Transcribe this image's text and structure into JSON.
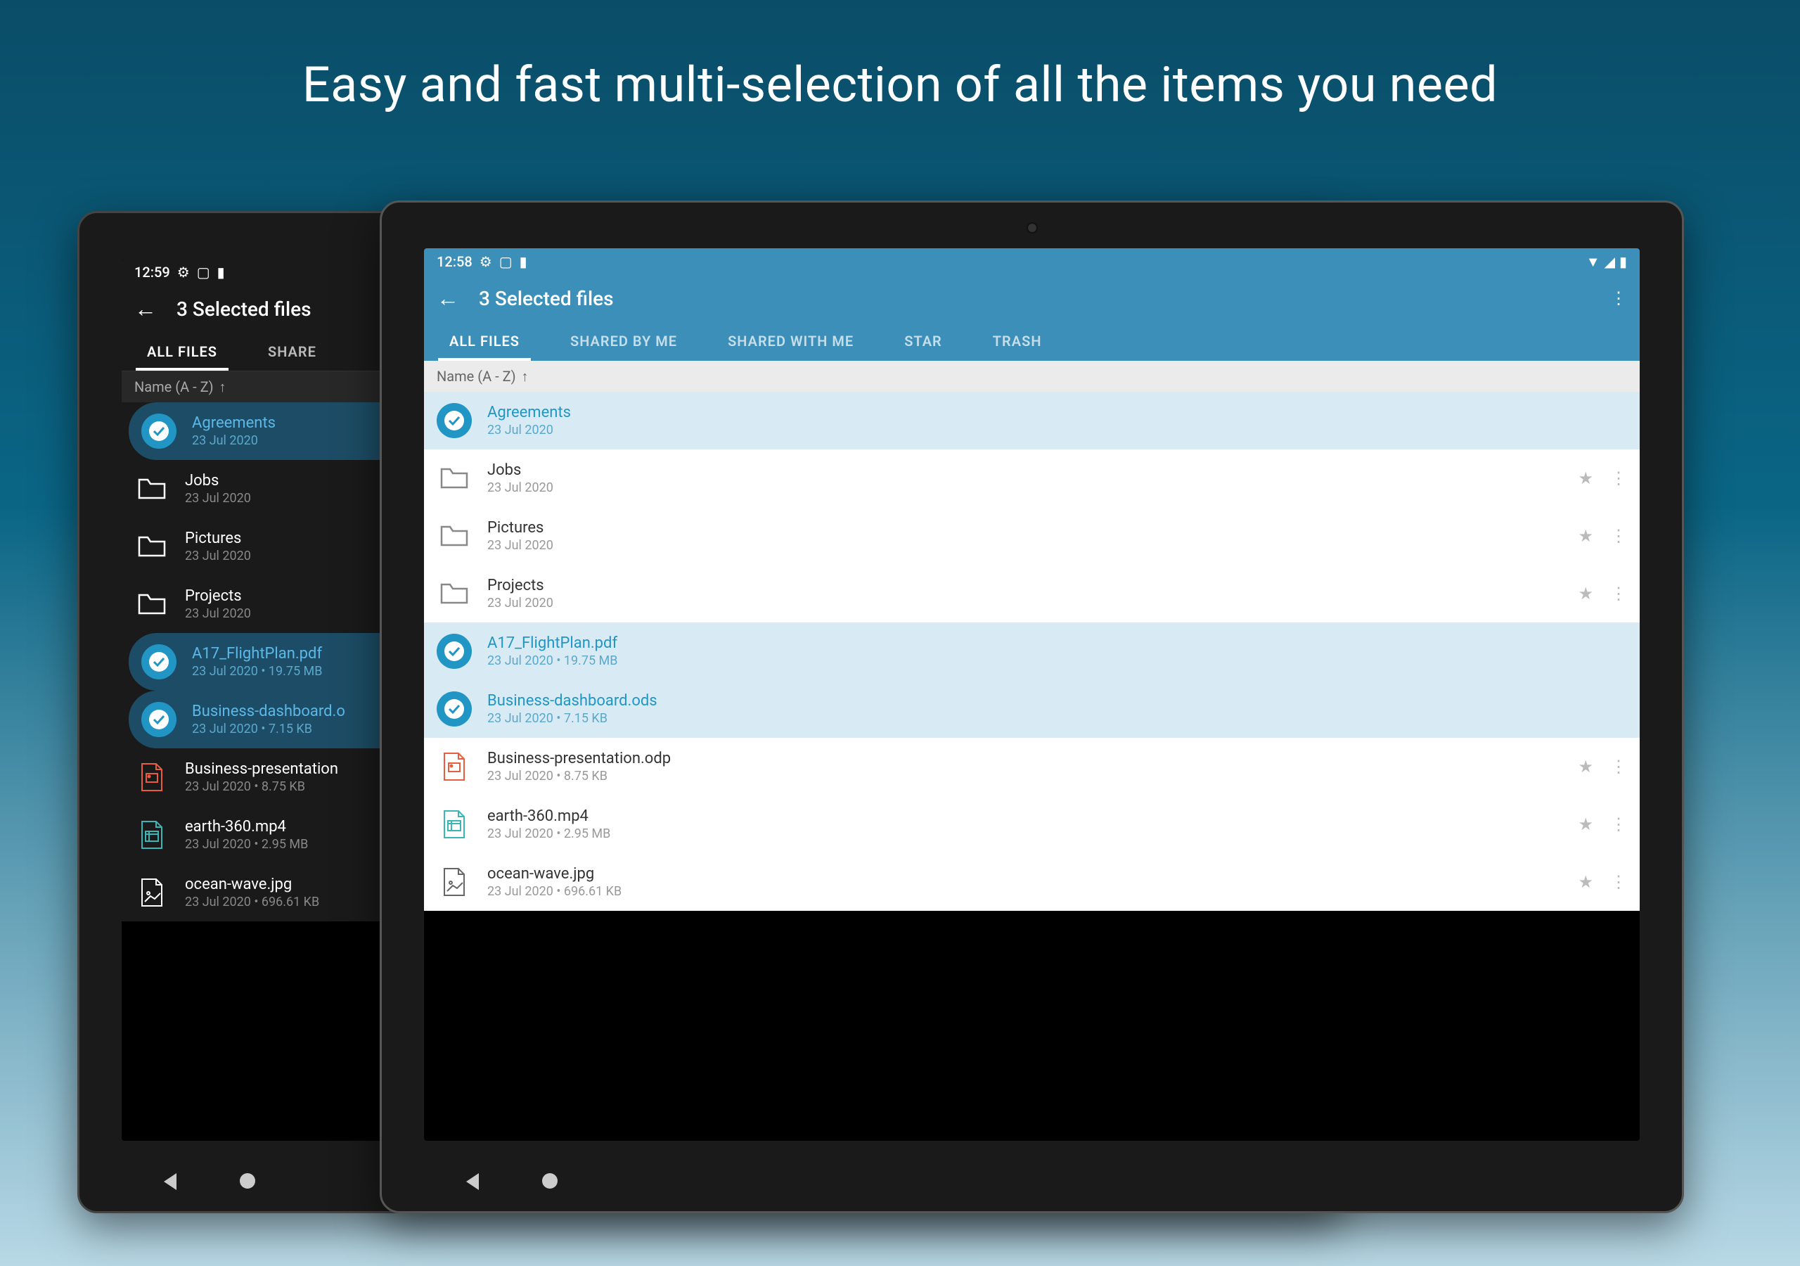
{
  "promo": {
    "title": "Easy and fast multi-selection of all the items you need"
  },
  "dark_device": {
    "status": {
      "time": "12:59"
    },
    "header": {
      "title": "3 Selected files"
    },
    "tabs": [
      "ALL FILES",
      "SHARE"
    ],
    "sort": {
      "label": "Name (A - Z)"
    },
    "files": [
      {
        "name": "Agreements",
        "meta": "23 Jul 2020",
        "type": "folder",
        "selected": true
      },
      {
        "name": "Jobs",
        "meta": "23 Jul 2020",
        "type": "folder",
        "selected": false
      },
      {
        "name": "Pictures",
        "meta": "23 Jul 2020",
        "type": "folder",
        "selected": false
      },
      {
        "name": "Projects",
        "meta": "23 Jul 2020",
        "type": "folder",
        "selected": false
      },
      {
        "name": "A17_FlightPlan.pdf",
        "meta": "23 Jul 2020 • 19.75 MB",
        "type": "pdf",
        "selected": true
      },
      {
        "name": "Business-dashboard.o",
        "meta": "23 Jul 2020 • 7.15 KB",
        "type": "ods",
        "selected": true
      },
      {
        "name": "Business-presentation",
        "meta": "23 Jul 2020 • 8.75 KB",
        "type": "odp",
        "selected": false,
        "color": "#e85d3d"
      },
      {
        "name": "earth-360.mp4",
        "meta": "23 Jul 2020 • 2.95 MB",
        "type": "video",
        "selected": false,
        "color": "#3bb5b5"
      },
      {
        "name": "ocean-wave.jpg",
        "meta": "23 Jul 2020 • 696.61 KB",
        "type": "image",
        "selected": false,
        "color": "#fff"
      }
    ]
  },
  "light_device": {
    "status": {
      "time": "12:58"
    },
    "header": {
      "title": "3 Selected files"
    },
    "tabs": [
      "ALL FILES",
      "SHARED BY ME",
      "SHARED WITH ME",
      "STAR",
      "TRASH"
    ],
    "sort": {
      "label": "Name (A - Z)"
    },
    "files": [
      {
        "name": "Agreements",
        "meta": "23 Jul 2020",
        "type": "folder",
        "selected": true
      },
      {
        "name": "Jobs",
        "meta": "23 Jul 2020",
        "type": "folder",
        "selected": false
      },
      {
        "name": "Pictures",
        "meta": "23 Jul 2020",
        "type": "folder",
        "selected": false
      },
      {
        "name": "Projects",
        "meta": "23 Jul 2020",
        "type": "folder",
        "selected": false
      },
      {
        "name": "A17_FlightPlan.pdf",
        "meta": "23 Jul 2020 • 19.75 MB",
        "type": "pdf",
        "selected": true
      },
      {
        "name": "Business-dashboard.ods",
        "meta": "23 Jul 2020 • 7.15 KB",
        "type": "ods",
        "selected": true
      },
      {
        "name": "Business-presentation.odp",
        "meta": "23 Jul 2020 • 8.75 KB",
        "type": "odp",
        "selected": false,
        "color": "#e85d3d"
      },
      {
        "name": "earth-360.mp4",
        "meta": "23 Jul 2020 • 2.95 MB",
        "type": "video",
        "selected": false,
        "color": "#3bb5b5"
      },
      {
        "name": "ocean-wave.jpg",
        "meta": "23 Jul 2020 • 696.61 KB",
        "type": "image",
        "selected": false,
        "color": "#666"
      }
    ]
  }
}
